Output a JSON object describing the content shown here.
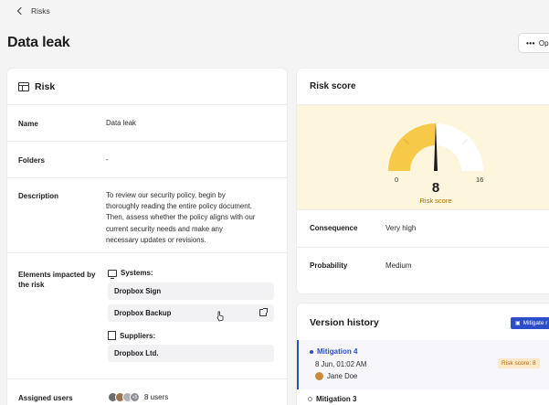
{
  "breadcrumb": {
    "label": "Risks"
  },
  "page_title": "Data leak",
  "options_label": "Op",
  "risk_card": {
    "title": "Risk",
    "rows": {
      "name": {
        "label": "Name",
        "value": "Data leak"
      },
      "folders": {
        "label": "Folders",
        "value": "-"
      },
      "description": {
        "label": "Description",
        "lines": [
          "To review our security policy, begin by",
          "thoroughly reading the entire policy document.",
          "Then, assess whether the policy aligns with our",
          "current security needs and make any",
          "necessary updates or revisions."
        ]
      },
      "elements": {
        "label_line1": "Elements impacted by",
        "label_line2": "the risk",
        "systems_label": "Systems:",
        "systems": [
          "Dropbox Sign",
          "Dropbox Backup"
        ],
        "suppliers_label": "Suppliers:",
        "suppliers": [
          "Dropbox Ltd."
        ]
      },
      "assigned": {
        "label": "Assigned users",
        "value": "8 users",
        "avatar_more": "+5"
      }
    }
  },
  "score_card": {
    "title": "Risk score",
    "gauge": {
      "min": "0",
      "max": "16",
      "value": 8,
      "value_text": "8",
      "caption": "Risk score"
    },
    "consequence": {
      "label": "Consequence",
      "value": "Very high"
    },
    "probability": {
      "label": "Probability",
      "value": "Medium"
    }
  },
  "version_card": {
    "title": "Version history",
    "mitigate_label": "Mitigate r",
    "items": [
      {
        "name": "Mitigation 4",
        "date": "8 Jun, 01:02 AM",
        "user": "Jane Doe",
        "badge": "Risk score: 8"
      },
      {
        "name": "Mitigation 3"
      }
    ]
  },
  "colors": {
    "accent": "#2c4fc9",
    "gauge_fill": "#f7c948",
    "gauge_bg": "#fdf5dc",
    "badge_bg": "#fde8c8"
  }
}
